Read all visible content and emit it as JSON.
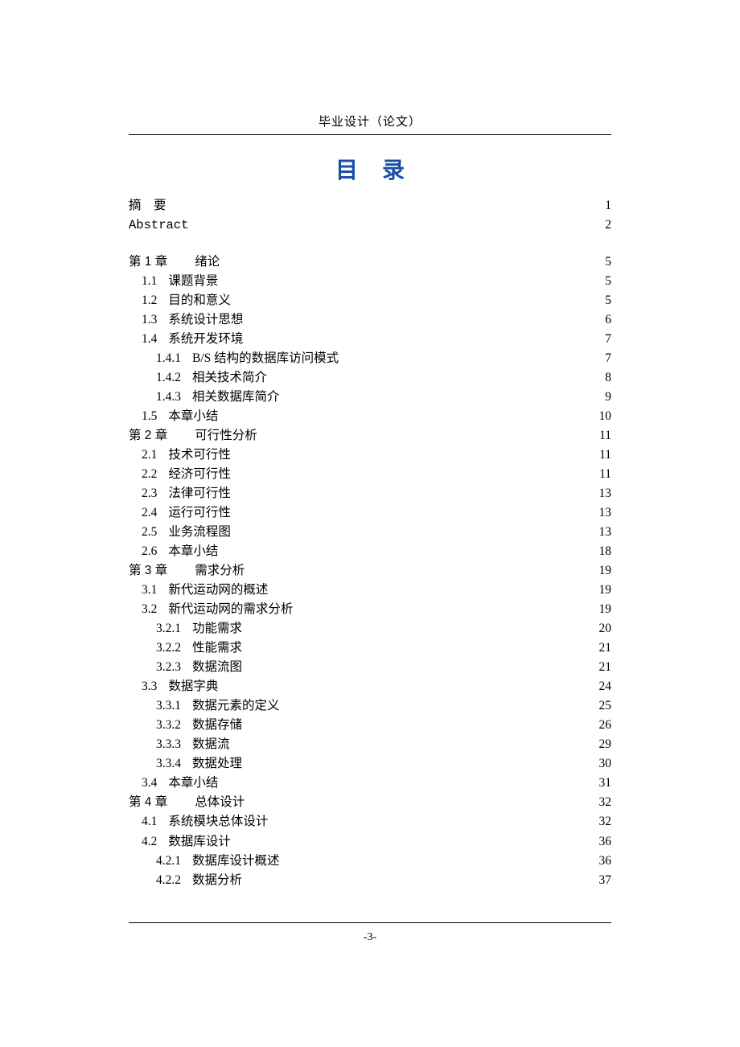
{
  "header": {
    "label": "毕业设计（论文）"
  },
  "title": "目录",
  "footer": {
    "page_number": "-3-"
  },
  "toc": [
    {
      "level": 1,
      "num": "",
      "text": "摘　要",
      "page": "1",
      "leader": "sparse",
      "gap": "none"
    },
    {
      "level": 1,
      "num": "",
      "text": "Abstract",
      "page": "2",
      "leader": "sparse",
      "gap": "none",
      "mono": true
    },
    {
      "spacer": true
    },
    {
      "level": 1,
      "num": "第 1 章",
      "text": "绪论",
      "page": "5",
      "leader": "sparse",
      "gap": "wide"
    },
    {
      "level": 2,
      "num": "1.1",
      "text": "课题背景",
      "page": "5",
      "leader": "dense"
    },
    {
      "level": 2,
      "num": "1.2",
      "text": "目的和意义",
      "page": "5",
      "leader": "dense"
    },
    {
      "level": 2,
      "num": "1.3",
      "text": "系统设计思想",
      "page": "6",
      "leader": "dense"
    },
    {
      "level": 2,
      "num": "1.4",
      "text": "系统开发环境",
      "page": "7",
      "leader": "dense"
    },
    {
      "level": 3,
      "num": "1.4.1",
      "text": "B/S 结构的数据库访问模式",
      "page": "7",
      "leader": "dense"
    },
    {
      "level": 3,
      "num": "1.4.2",
      "text": "相关技术简介",
      "page": "8",
      "leader": "dense"
    },
    {
      "level": 3,
      "num": "1.4.3",
      "text": "相关数据库简介",
      "page": "9",
      "leader": "dense"
    },
    {
      "level": 2,
      "num": "1.5",
      "text": "本章小结",
      "page": "10",
      "leader": "dense"
    },
    {
      "level": 1,
      "num": "第 2 章",
      "text": "可行性分析",
      "page": "11",
      "leader": "sparse",
      "gap": "wide"
    },
    {
      "level": 2,
      "num": "2.1",
      "text": "技术可行性",
      "page": "11",
      "leader": "dense"
    },
    {
      "level": 2,
      "num": "2.2",
      "text": "经济可行性",
      "page": "11",
      "leader": "dense"
    },
    {
      "level": 2,
      "num": "2.3",
      "text": "法律可行性",
      "page": "13",
      "leader": "dense"
    },
    {
      "level": 2,
      "num": "2.4",
      "text": "运行可行性",
      "page": "13",
      "leader": "dense"
    },
    {
      "level": 2,
      "num": "2.5",
      "text": "业务流程图",
      "page": "13",
      "leader": "dense"
    },
    {
      "level": 2,
      "num": "2.6",
      "text": "本章小结",
      "page": "18",
      "leader": "dense"
    },
    {
      "level": 1,
      "num": "第 3 章",
      "text": "需求分析",
      "page": "19",
      "leader": "sparse",
      "gap": "wide"
    },
    {
      "level": 2,
      "num": "3.1",
      "text": "新代运动网的概述",
      "page": "19",
      "leader": "dense"
    },
    {
      "level": 2,
      "num": "3.2",
      "text": "新代运动网的需求分析",
      "page": "19",
      "leader": "dense"
    },
    {
      "level": 3,
      "num": "3.2.1",
      "text": "功能需求",
      "page": "20",
      "leader": "dense"
    },
    {
      "level": 3,
      "num": "3.2.2",
      "text": "性能需求",
      "page": "21",
      "leader": "dense"
    },
    {
      "level": 3,
      "num": "3.2.3",
      "text": "数据流图",
      "page": "21",
      "leader": "dense"
    },
    {
      "level": 2,
      "num": "3.3",
      "text": "数据字典",
      "page": "24",
      "leader": "dense"
    },
    {
      "level": 3,
      "num": "3.3.1",
      "text": "数据元素的定义",
      "page": "25",
      "leader": "dense"
    },
    {
      "level": 3,
      "num": "3.3.2",
      "text": "数据存储",
      "page": "26",
      "leader": "dense"
    },
    {
      "level": 3,
      "num": "3.3.3",
      "text": "数据流",
      "page": "29",
      "leader": "dense"
    },
    {
      "level": 3,
      "num": "3.3.4",
      "text": "数据处理",
      "page": "30",
      "leader": "dense"
    },
    {
      "level": 2,
      "num": "3.4",
      "text": "本章小结",
      "page": "31",
      "leader": "dense"
    },
    {
      "level": 1,
      "num": "第 4 章",
      "text": "总体设计",
      "page": "32",
      "leader": "sparse",
      "gap": "wide"
    },
    {
      "level": 2,
      "num": "4.1",
      "text": "系统模块总体设计",
      "page": "32",
      "leader": "dense"
    },
    {
      "level": 2,
      "num": "4.2",
      "text": "数据库设计",
      "page": "36",
      "leader": "dense"
    },
    {
      "level": 3,
      "num": "4.2.1",
      "text": "数据库设计概述",
      "page": "36",
      "leader": "dense"
    },
    {
      "level": 3,
      "num": "4.2.2",
      "text": "数据分析",
      "page": "37",
      "leader": "dense"
    }
  ]
}
